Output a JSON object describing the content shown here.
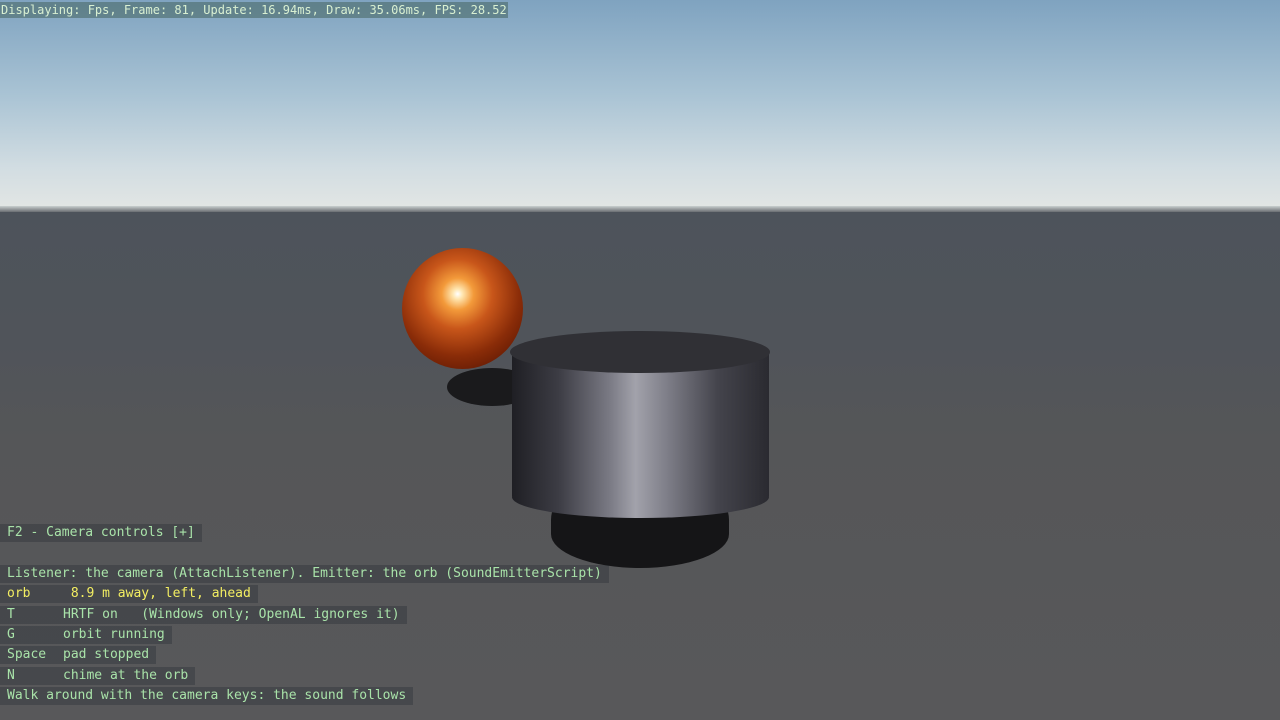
{
  "fps_overlay": "Displaying: Fps, Frame: 81, Update: 16.94ms, Draw: 35.06ms, FPS: 28.52",
  "camera_controls": "F2 - Camera controls [+]",
  "info": "Listener: the camera (AttachListener). Emitter: the orb (SoundEmitterScript)",
  "orb_status": {
    "key": "orb",
    "text": " 8.9 m away, left, ahead"
  },
  "bindings": [
    {
      "key": "T",
      "text": "HRTF on   (Windows only; OpenAL ignores it)"
    },
    {
      "key": "G",
      "text": "orbit running"
    },
    {
      "key": "Space",
      "text": "pad stopped"
    },
    {
      "key": "N",
      "text": "chime at the orb"
    }
  ],
  "footer": "Walk around with the camera keys: the sound follows",
  "colors": {
    "hud_text": "#a9e3a9",
    "highlight_text": "#f3ee62",
    "orb": "#c8561a",
    "cylinder": "#6e6e78"
  }
}
